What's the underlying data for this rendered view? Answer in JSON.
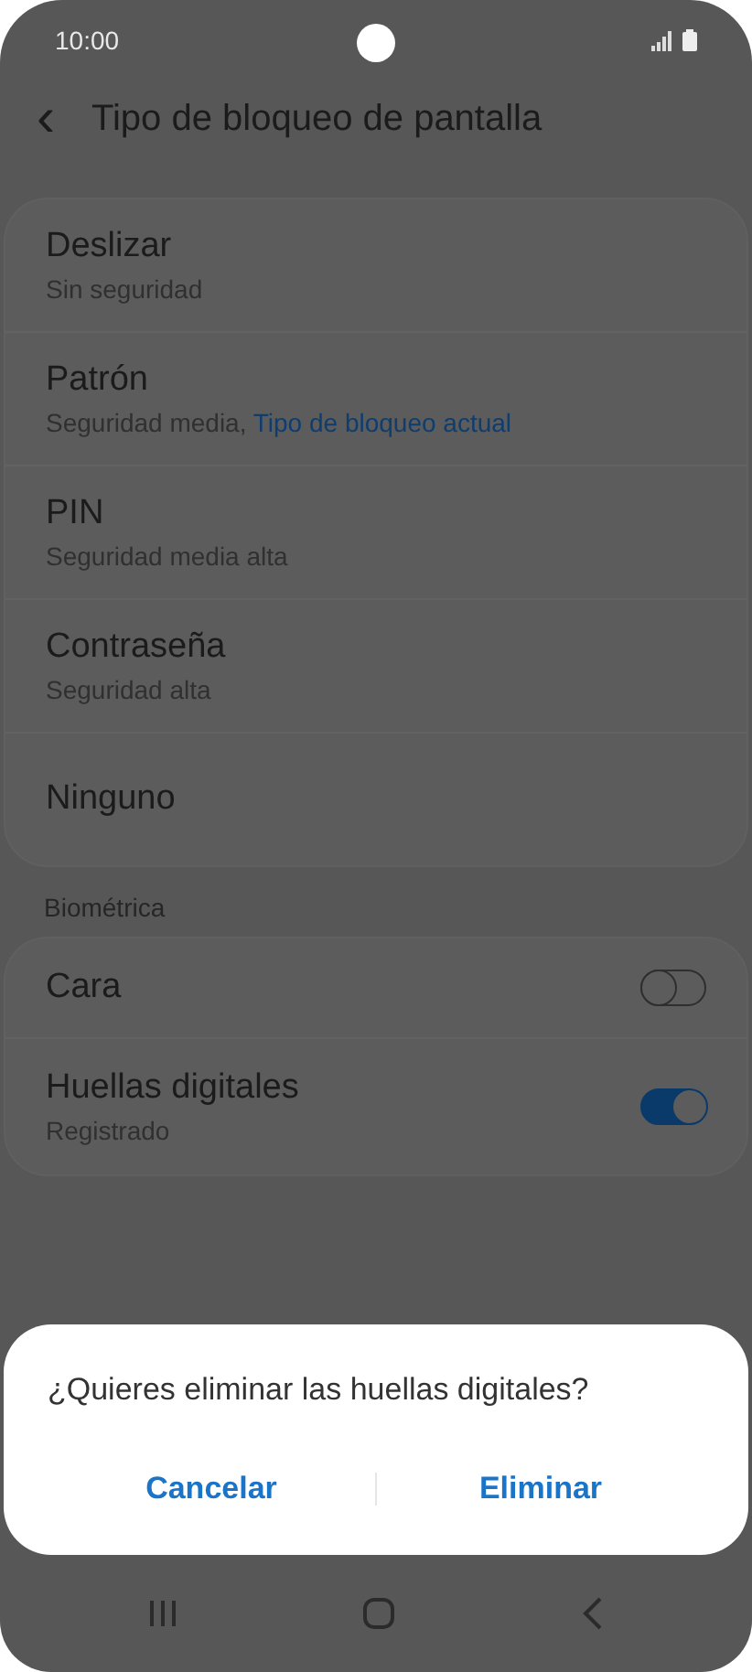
{
  "status_bar": {
    "time": "10:00"
  },
  "header": {
    "back": "‹",
    "title": "Tipo de bloqueo de pantalla"
  },
  "lock_types": [
    {
      "title": "Deslizar",
      "subtitle": "Sin seguridad"
    },
    {
      "title": "Patrón",
      "subtitle": "Seguridad media, ",
      "subtitle_link": "Tipo de bloqueo actual"
    },
    {
      "title": "PIN",
      "subtitle": "Seguridad media alta"
    },
    {
      "title": "Contraseña",
      "subtitle": "Seguridad alta"
    },
    {
      "title": "Ninguno"
    }
  ],
  "biometrics": {
    "heading": "Biométrica",
    "items": [
      {
        "title": "Cara",
        "on": false
      },
      {
        "title": "Huellas digitales",
        "subtitle": "Registrado",
        "on": true
      }
    ]
  },
  "dialog": {
    "message": "¿Quieres eliminar las huellas digitales?",
    "buttons": [
      "Cancelar",
      "Eliminar"
    ]
  }
}
